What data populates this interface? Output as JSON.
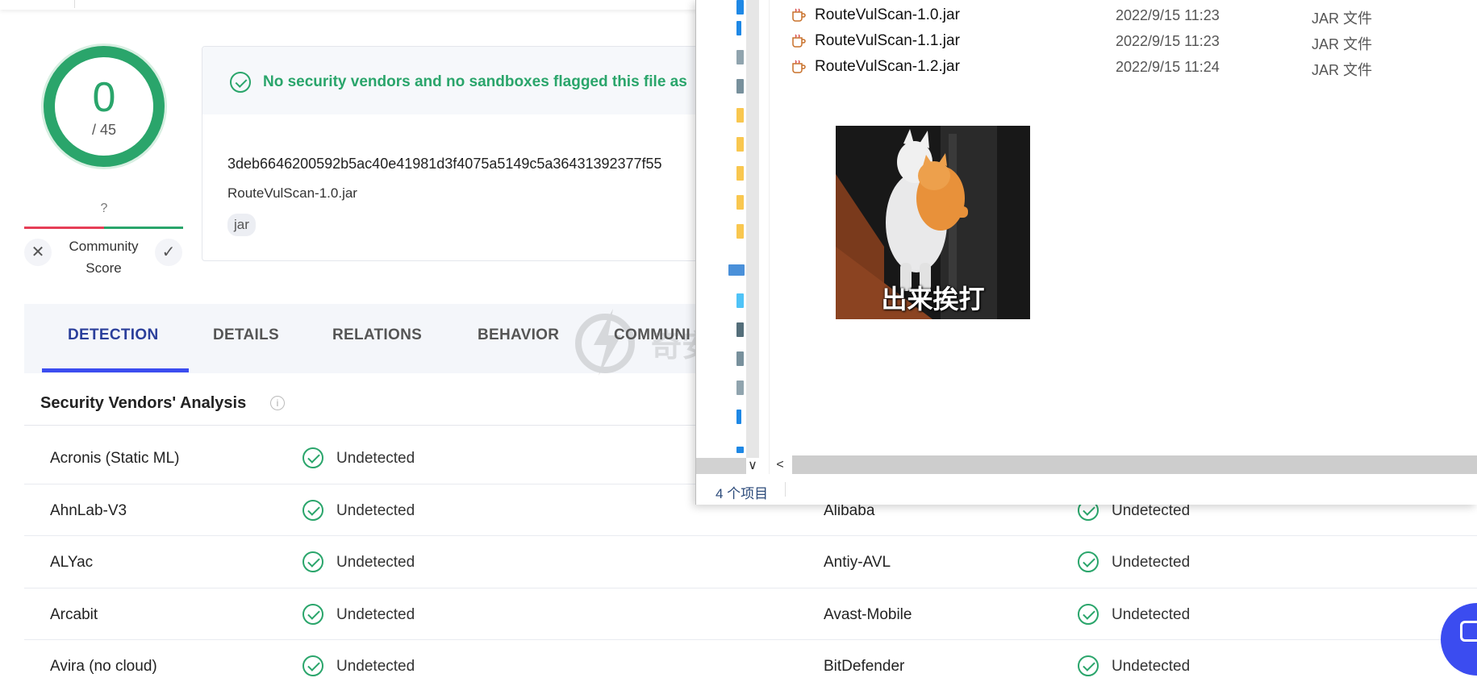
{
  "score": {
    "detections": "0",
    "total": "/ 45"
  },
  "community": {
    "question": "?",
    "label_line1": "Community",
    "label_line2": "Score",
    "dislike_glyph": "✕",
    "like_glyph": "✓"
  },
  "summary": {
    "banner": "No security vendors and no sandboxes flagged this file as",
    "hash": "3deb6646200592b5ac40e41981d3f4075a5149c5a36431392377f55",
    "filename": "RouteVulScan-1.0.jar",
    "tag": "jar"
  },
  "tabs": [
    {
      "label": "DETECTION"
    },
    {
      "label": "DETAILS"
    },
    {
      "label": "RELATIONS"
    },
    {
      "label": "BEHAVIOR"
    },
    {
      "label": "COMMUNI"
    }
  ],
  "watermark": "奇安信攻防社区",
  "section": {
    "title": "Security Vendors' Analysis",
    "info_glyph": "i"
  },
  "vendors_left": [
    {
      "name": "Acronis (Static ML)",
      "status": "Undetected"
    },
    {
      "name": "AhnLab-V3",
      "status": "Undetected"
    },
    {
      "name": "ALYac",
      "status": "Undetected"
    },
    {
      "name": "Arcabit",
      "status": "Undetected"
    },
    {
      "name": "Avira (no cloud)",
      "status": "Undetected"
    }
  ],
  "vendors_right": [
    {
      "name": "Alibaba",
      "status": "Undetected"
    },
    {
      "name": "Antiy-AVL",
      "status": "Undetected"
    },
    {
      "name": "Avast-Mobile",
      "status": "Undetected"
    },
    {
      "name": "BitDefender",
      "status": "Undetected"
    }
  ],
  "explorer": {
    "files": [
      {
        "name": "RouteVulScan-1.0.jar",
        "date": "2022/9/15 11:23",
        "type": "JAR 文件"
      },
      {
        "name": "RouteVulScan-1.1.jar",
        "date": "2022/9/15 11:23",
        "type": "JAR 文件"
      },
      {
        "name": "RouteVulScan-1.2.jar",
        "date": "2022/9/15 11:24",
        "type": "JAR 文件"
      }
    ],
    "status": "4 个项目",
    "scroll_down_glyph": "∨",
    "scroll_left_glyph": "<"
  },
  "meme": {
    "caption": "出来挨打"
  },
  "colors": {
    "accent_green": "#2aa56b",
    "accent_blue": "#3b4cf0",
    "alert_red": "#e63f57"
  }
}
